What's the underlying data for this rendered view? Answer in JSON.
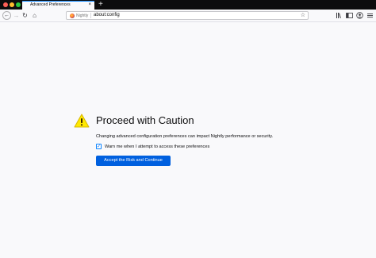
{
  "browser": {
    "tab": {
      "title": "Advanced Preferences",
      "close_icon": "×"
    },
    "new_tab_icon": "+",
    "nav": {
      "back_icon": "←",
      "forward_icon": "→",
      "reload_icon": "↻",
      "home_icon": "⌂"
    },
    "urlbar": {
      "brand": "Nightly",
      "url": "about:config",
      "bookmark_icon": "☆"
    },
    "toolbar_icons": [
      "library-icon",
      "sidebar-icon",
      "account-icon",
      "menu-icon"
    ],
    "colors": {
      "tabstrip": "#0c0c0d",
      "accent": "#0a84ff",
      "button": "#0060df",
      "warning": "#ffe900"
    }
  },
  "caution": {
    "title": "Proceed with Caution",
    "description": "Changing advanced configuration preferences can impact Nightly performance or security.",
    "checkbox_checked": true,
    "checkbox_mark": "✓",
    "checkbox_label": "Warn me when I attempt to access these preferences",
    "accept_button": "Accept the Risk and Continue"
  }
}
